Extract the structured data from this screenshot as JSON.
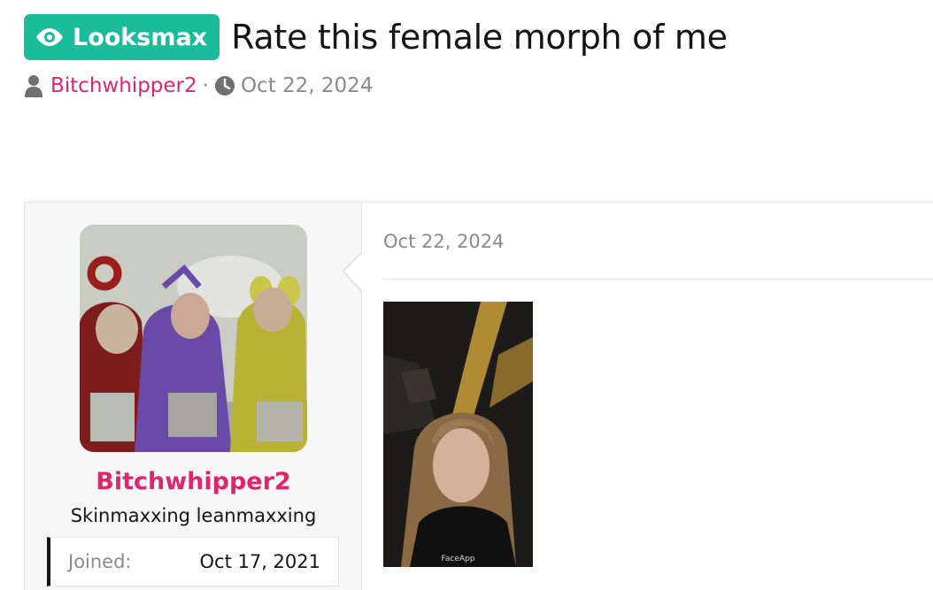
{
  "thread": {
    "prefix": "Looksmax",
    "title": "Rate this female morph of me",
    "author": "Bitchwhipper2",
    "separator": "·",
    "date": "Oct 22, 2024"
  },
  "post": {
    "username": "Bitchwhipper2",
    "user_title": "Skinmaxxing leanmaxxing",
    "joined_label": "Joined:",
    "joined_value": "Oct 17, 2021",
    "date": "Oct 22, 2024",
    "image_watermark": "FaceApp"
  },
  "colors": {
    "prefix_badge": "#1abc9c",
    "username": "#e0256a",
    "muted": "#8a8a8a"
  },
  "icons": {
    "prefix": "eye-icon",
    "author": "user-icon",
    "date": "clock-icon"
  }
}
